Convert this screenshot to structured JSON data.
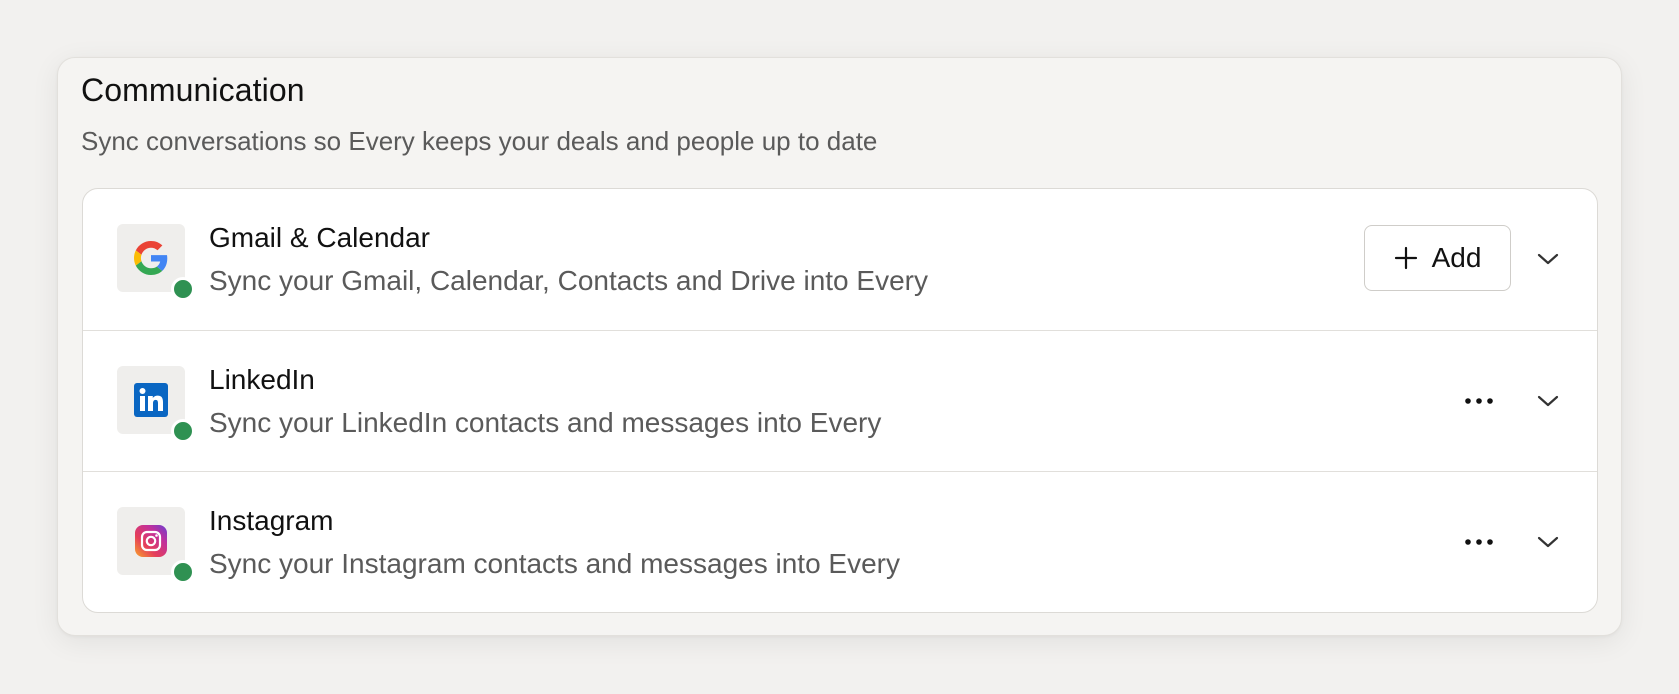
{
  "section": {
    "title": "Communication",
    "subtitle": "Sync conversations so Every keeps your deals and people up to date"
  },
  "integrations": [
    {
      "name": "Gmail & Calendar",
      "description": "Sync your Gmail, Calendar, Contacts and Drive into Every",
      "icon": "google-icon",
      "status": "connected",
      "action": "add",
      "action_label": "Add"
    },
    {
      "name": "LinkedIn",
      "description": "Sync your LinkedIn contacts and messages into Every",
      "icon": "linkedin-icon",
      "status": "connected",
      "action": "more"
    },
    {
      "name": "Instagram",
      "description": "Sync your Instagram contacts and messages into Every",
      "icon": "instagram-icon",
      "status": "connected",
      "action": "more"
    }
  ],
  "colors": {
    "status_connected": "#2f9152",
    "linkedin_blue": "#0a66c2",
    "page_background": "#f2f1ef"
  }
}
